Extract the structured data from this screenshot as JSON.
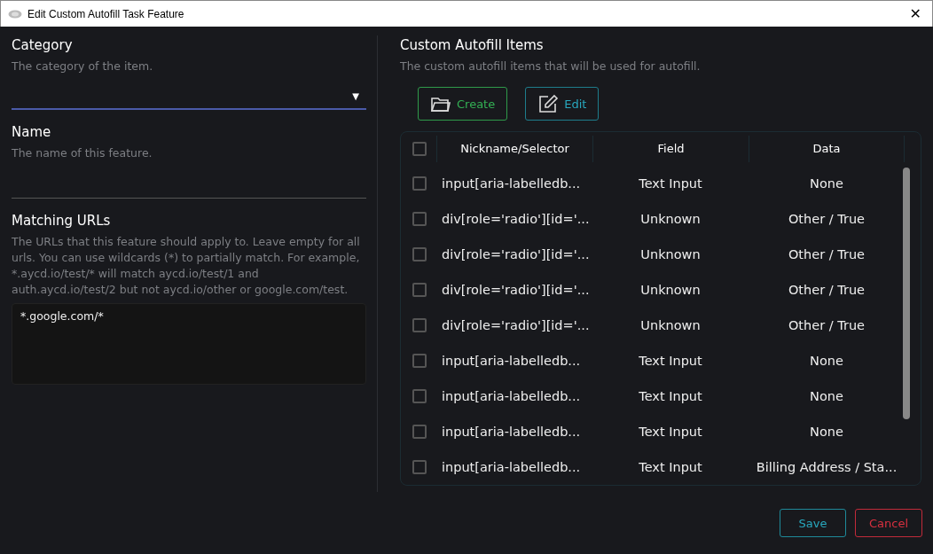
{
  "window": {
    "title": "Edit Custom Autofill Task Feature",
    "close": "✕"
  },
  "category": {
    "label": "Category",
    "description": "The category of the item.",
    "caret": "▼"
  },
  "name": {
    "label": "Name",
    "description": "The name of this feature."
  },
  "matching_urls": {
    "label": "Matching URLs",
    "description": "The URLs that this feature should apply to. Leave empty for all urls. You can use wildcards (*) to partially match. For example, *.aycd.io/test/* will match aycd.io/test/1 and auth.aycd.io/test/2 but not aycd.io/other or google.com/test.",
    "value": "*.google.com/*"
  },
  "items": {
    "label": "Custom Autofill Items",
    "description": "The custom autofill items that will be used for autofill.",
    "toolbar": [
      {
        "kind": "create",
        "label": "Create"
      },
      {
        "kind": "edit",
        "label": "Edit"
      }
    ],
    "table": {
      "select_all_checked": false,
      "columns": [
        "Nickname/Selector",
        "Field",
        "Data"
      ],
      "rows": [
        {
          "checked": false,
          "cells": [
            "input[aria-labelledb...",
            "Text Input",
            "None"
          ]
        },
        {
          "checked": false,
          "cells": [
            "div[role='radio'][id='...",
            "Unknown",
            "Other / True"
          ]
        },
        {
          "checked": false,
          "cells": [
            "div[role='radio'][id='...",
            "Unknown",
            "Other / True"
          ]
        },
        {
          "checked": false,
          "cells": [
            "div[role='radio'][id='...",
            "Unknown",
            "Other / True"
          ]
        },
        {
          "checked": false,
          "cells": [
            "div[role='radio'][id='...",
            "Unknown",
            "Other / True"
          ]
        },
        {
          "checked": false,
          "cells": [
            "input[aria-labelledb...",
            "Text Input",
            "None"
          ]
        },
        {
          "checked": false,
          "cells": [
            "input[aria-labelledb...",
            "Text Input",
            "None"
          ]
        },
        {
          "checked": false,
          "cells": [
            "input[aria-labelledb...",
            "Text Input",
            "None"
          ]
        },
        {
          "checked": false,
          "cells": [
            "input[aria-labelledb...",
            "Text Input",
            "Billing Address / Sta..."
          ]
        }
      ]
    }
  },
  "buttons": [
    {
      "kind": "save",
      "label": "Save"
    },
    {
      "kind": "cancel",
      "label": "Cancel"
    }
  ]
}
